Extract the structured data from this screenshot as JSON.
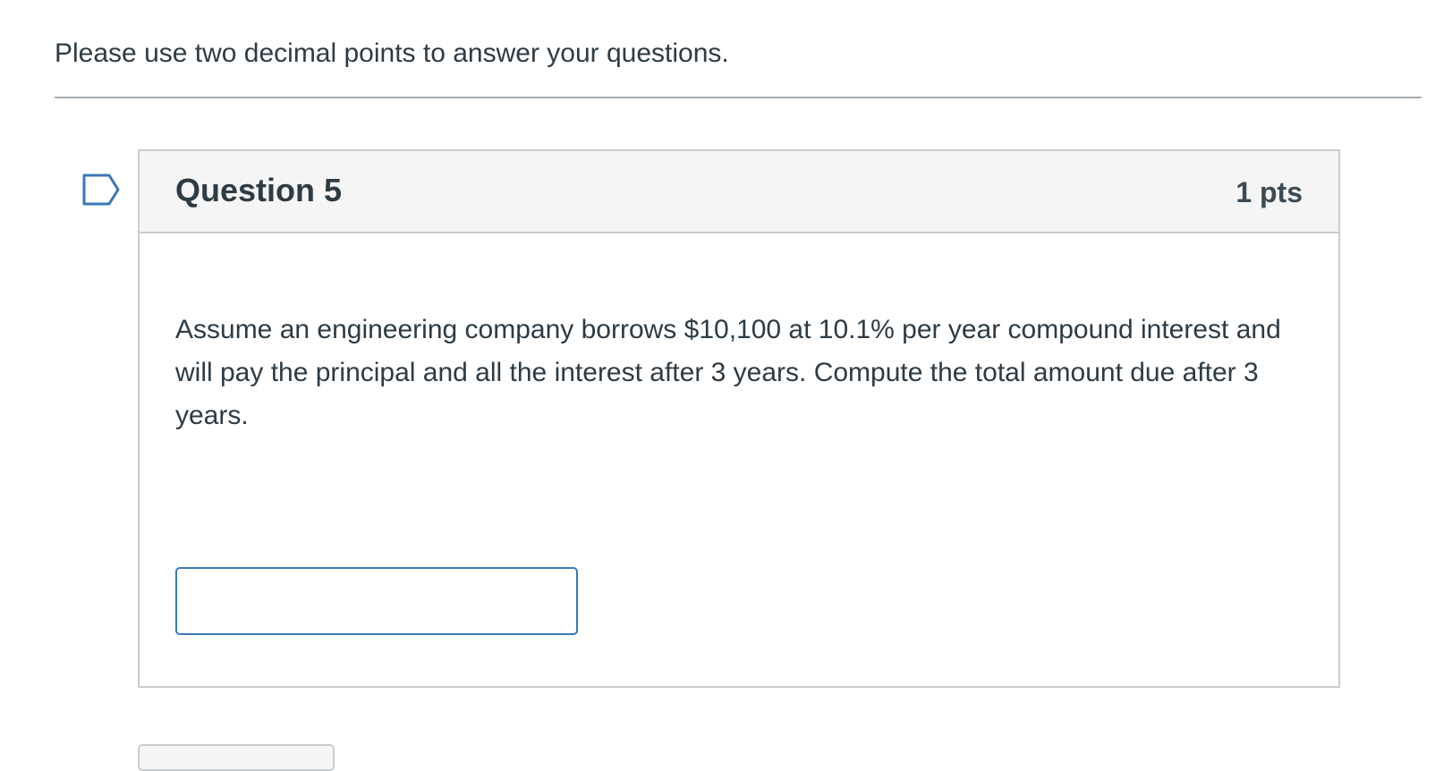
{
  "intro": {
    "text": "Please use two decimal points to answer your questions."
  },
  "question": {
    "flag_icon": "bookmark-flag-icon",
    "title": "Question 5",
    "points": "1 pts",
    "text": "Assume an engineering company borrows $10,100 at 10.1% per year compound interest and will pay the principal and all the interest after 3 years. Compute the total amount due after 3 years.",
    "answer": {
      "value": "",
      "placeholder": ""
    }
  },
  "colors": {
    "text": "#2d3b45",
    "border": "#c7cdd1",
    "header_bg": "#f5f5f5",
    "input_border": "#3a77b8",
    "flag_stroke": "#3a77b8"
  }
}
